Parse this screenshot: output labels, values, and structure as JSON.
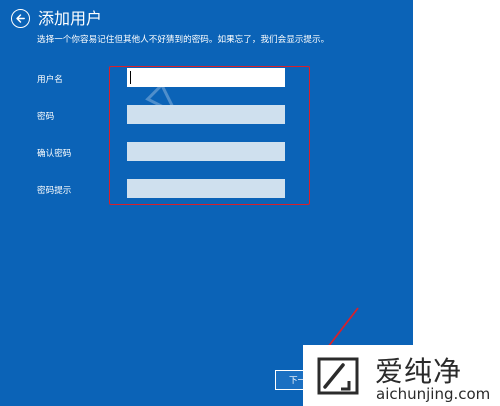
{
  "header": {
    "title": "添加用户",
    "subtitle": "选择一个你容易记住但其他人不好猜到的密码。如果忘了，我们会显示提示。"
  },
  "form": {
    "fields": [
      {
        "label": "用户名",
        "value": ""
      },
      {
        "label": "密码",
        "value": ""
      },
      {
        "label": "确认密码",
        "value": ""
      },
      {
        "label": "密码提示",
        "value": ""
      }
    ]
  },
  "footer": {
    "next_label": "下一"
  },
  "watermark": {
    "brand_cn": "爱纯净",
    "brand_en": "aichunjing.com"
  },
  "colors": {
    "panel_bg": "#0b63b7",
    "input_bg": "#cfe0ee",
    "highlight": "#d9202a",
    "text": "#ffffff"
  },
  "icons": {
    "back": "back-arrow-circle-icon",
    "logo": "aichunjing-logo-icon"
  }
}
